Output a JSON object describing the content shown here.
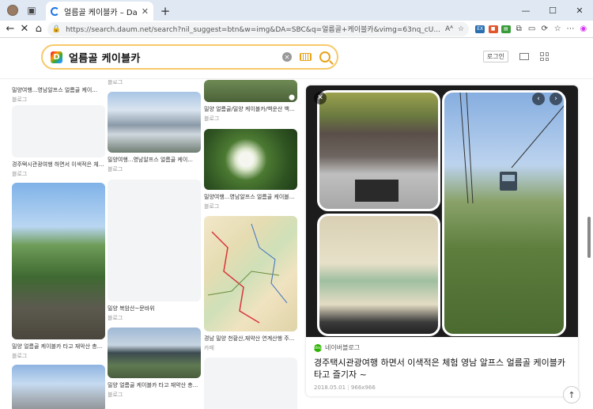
{
  "browser": {
    "tab_title": "얼름골 케이블카 – Daum 검색",
    "url": "https://search.daum.net/search?nil_suggest=btn&w=img&DA=SBC&q=얼름골+케이블카&vimg=63nq_cU...",
    "win_min": "—",
    "win_max": "☐",
    "win_close": "✕"
  },
  "search": {
    "query": "얼름골 케이블카",
    "login_label": "로그인"
  },
  "results": {
    "col1": [
      {
        "title": "밀양여행...영남알프스 얼름골 케이...",
        "source": "블로그"
      },
      {
        "title": "경주택시관광여행 하면서 이색적은 체험...",
        "source": "블로그"
      },
      {
        "title": "밀양 얼름골 케이블카 타고 재악산 총...",
        "source": "블로그"
      }
    ],
    "col2": [
      {
        "title": "",
        "source": "블로그"
      },
      {
        "title": "밀양여행...영남알프스 얼름골 케이...",
        "source": "블로그"
      },
      {
        "title": "밀양 복암산~문바위",
        "source": "블로그"
      },
      {
        "title": "밀양 얼름골 케이블카 타고 재약산 총...",
        "source": "블로그"
      }
    ],
    "col3": [
      {
        "title": "밀양 얼름골/밀양 케이블카/백운산 백...",
        "source": "블로그"
      },
      {
        "title": "밀양여행...영남알프스 얼름골 케이블...",
        "source": "블로그"
      },
      {
        "title": "경남 밀양 천황산,재약산 연계산행 주...",
        "source": "카페"
      }
    ]
  },
  "detail": {
    "source_name": "네이버블로그",
    "source_icon_text": "blog",
    "title": "경주택시관광여행 하면서 이색적은 체험 영남 알프스 얼름골 케이블카 타고 즐기자 ~",
    "date": "2018.05.01",
    "dimensions": "966x966"
  }
}
